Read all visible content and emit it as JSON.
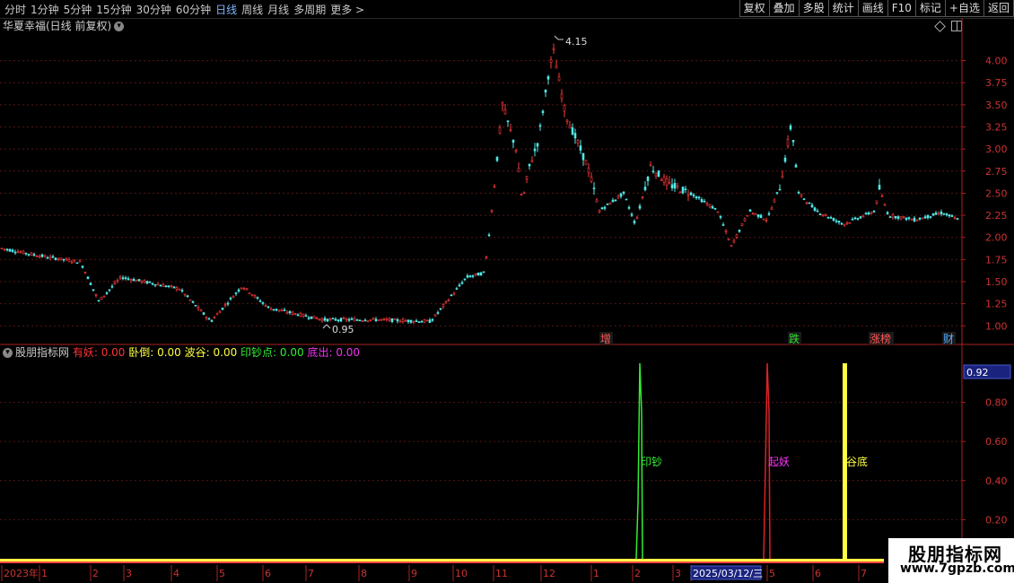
{
  "toolbar": {
    "periods": [
      "分时",
      "1分钟",
      "5分钟",
      "15分钟",
      "30分钟",
      "60分钟",
      "日线",
      "周线",
      "月线",
      "多周期",
      "更多 >"
    ],
    "active_period": "日线",
    "actions": [
      "复权",
      "叠加",
      "多股",
      "统计",
      "画线",
      "F10",
      "标记",
      "+自选",
      "返回"
    ]
  },
  "stock": {
    "title": "华夏幸福(日线 前复权)",
    "high_label": "4.15",
    "low_label": "0.95"
  },
  "price_axis": {
    "ticks": [
      "4.00",
      "3.75",
      "3.50",
      "3.25",
      "3.00",
      "2.75",
      "2.50",
      "2.25",
      "2.00",
      "1.75",
      "1.50",
      "1.25",
      "1.00"
    ],
    "values": [
      4.0,
      3.75,
      3.5,
      3.25,
      3.0,
      2.75,
      2.5,
      2.25,
      2.0,
      1.75,
      1.5,
      1.25,
      1.0
    ],
    "range": [
      0.8,
      4.3
    ]
  },
  "events": [
    {
      "label": "增",
      "color": "#ff5555"
    },
    {
      "label": "跌",
      "color": "#33dd33"
    },
    {
      "label": "涨榜",
      "color": "#ff5555"
    },
    {
      "label": "财",
      "color": "#55aaff"
    }
  ],
  "indicator": {
    "name": "股朋指标网",
    "fields": [
      {
        "label": "有妖:",
        "value": "0.00",
        "color": "#ff3333"
      },
      {
        "label": "卧倒:",
        "value": "0.00",
        "color": "#ffff44"
      },
      {
        "label": "波谷:",
        "value": "0.00",
        "color": "#ffff44"
      },
      {
        "label": "印钞点:",
        "value": "0.00",
        "color": "#33ee33"
      },
      {
        "label": "底出:",
        "value": "0.00",
        "color": "#ee33ee"
      }
    ],
    "axis_ticks": [
      "0.80",
      "0.60",
      "0.40",
      "0.20"
    ],
    "axis_values": [
      0.8,
      0.6,
      0.4,
      0.2
    ],
    "current_value": "0.92",
    "signals": [
      {
        "label": "印钞",
        "color": "#33ee33"
      },
      {
        "label": "起妖",
        "color": "#ff33ff"
      },
      {
        "label": "谷底",
        "color": "#ffff44"
      }
    ]
  },
  "time_axis": {
    "labels": [
      "2023年",
      "1",
      "2",
      "3",
      "4",
      "5",
      "6",
      "7",
      "8",
      "9",
      "10",
      "11",
      "12",
      "1",
      "2",
      "3",
      "2025/03/12/三",
      "5",
      "6",
      "7"
    ]
  },
  "watermark": {
    "line1": "股朋指标网",
    "line2": "www.7gpzb.com"
  }
}
